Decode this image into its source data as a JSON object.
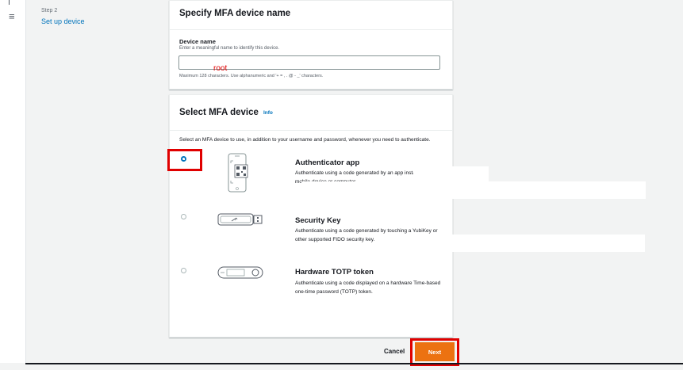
{
  "nav": {
    "step_label": "Step 2",
    "step_title": "Set up device"
  },
  "name_panel": {
    "title": "Specify MFA device name",
    "field_label": "Device name",
    "field_description": "Enter a meaningful name to identify this device.",
    "field_value": "root",
    "field_hint": "Maximum 128 characters. Use alphanumeric and '+ = , . @ - _' characters."
  },
  "device_panel": {
    "title": "Select MFA device",
    "info_label": "Info",
    "description": "Select an MFA device to use, in addition to your username and password, whenever you need to authenticate.",
    "options": [
      {
        "title": "Authenticator app",
        "description": "Authenticate using a code generated by an app installed on your mobile device or computer.",
        "selected": true,
        "icon": "phone-qr-icon"
      },
      {
        "title": "Security Key",
        "description": "Authenticate using a code generated by touching a YubiKey or other supported FIDO security key.",
        "selected": false,
        "icon": "usb-key-icon"
      },
      {
        "title": "Hardware TOTP token",
        "description": "Authenticate using a code displayed on a hardware Time-based one-time password (TOTP) token.",
        "selected": false,
        "icon": "totp-token-icon"
      }
    ]
  },
  "footer": {
    "cancel_label": "Cancel",
    "next_label": "Next"
  },
  "colors": {
    "accent": "#0073bb",
    "primary_button": "#ec7211",
    "highlight": "#e00000"
  }
}
